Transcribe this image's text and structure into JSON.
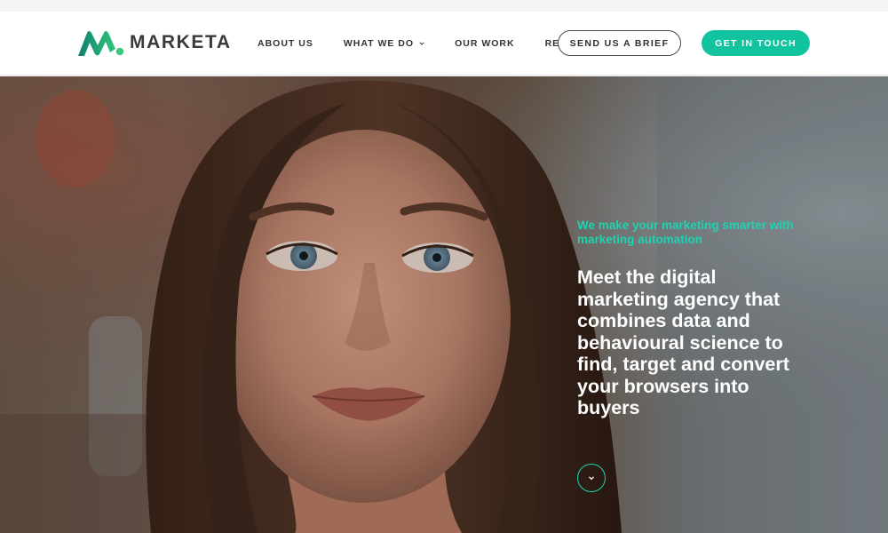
{
  "brand": {
    "name": "MARKETA",
    "accent": "#12c3a0",
    "logo_gradient": [
      "#0f7f6e",
      "#2fc27c"
    ]
  },
  "nav": {
    "items": [
      {
        "label": "ABOUT US",
        "has_dropdown": false
      },
      {
        "label": "WHAT WE DO",
        "has_dropdown": true
      },
      {
        "label": "OUR WORK",
        "has_dropdown": false
      },
      {
        "label": "RESOURCES",
        "has_dropdown": false
      }
    ],
    "brief_button": "SEND US A BRIEF",
    "contact_button": "GET IN TOUCH"
  },
  "hero": {
    "tagline": "We make your marketing smarter with marketing automation",
    "headline": "Meet the digital marketing agency that combines data and behavioural science to find, target and convert your browsers into buyers",
    "scroll_icon": "chevron-down-icon"
  }
}
